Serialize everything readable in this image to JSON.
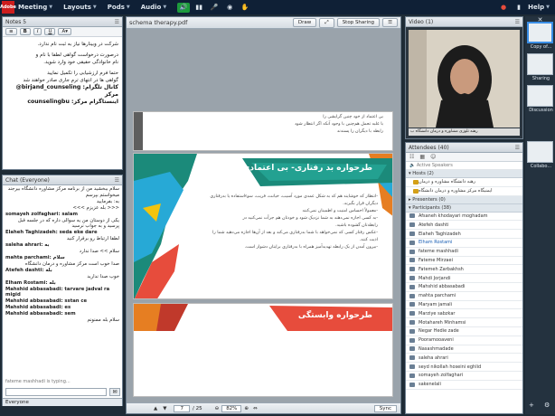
{
  "topbar": {
    "logo": "Adobe",
    "menus": [
      "Meeting",
      "Layouts",
      "Pods",
      "Audio"
    ],
    "help": "Help"
  },
  "notes": {
    "title": "Notes 5",
    "lines": [
      "شرکت در وبینارها نیاز به ثبت نام ندارد.",
      "درصورت درخواست گواهی لطفا با نام و",
      "نام خانوادگی حقیقی خود وارد شوید.",
      "",
      "حتما فرم ارزشیابی را تکمیل نمایید",
      "گواهی ها در انتهای ترم جاری صادر خواهند شد",
      "@birjand_counseling :کانال تلگرام مرکز",
      "counselingbu :اینستاگرام مرکز"
    ]
  },
  "chat": {
    "title": "Chat",
    "audience": "(Everyone)",
    "lines": [
      {
        "t": "سلام ببخشید من از برنامه مرکز مشاوره دانشگاه بیرجند",
        "rtl": true,
        "b": false
      },
      {
        "t": "میخواستم بپرسم",
        "rtl": true,
        "b": false
      },
      {
        "t": "به: بفرمایید",
        "rtl": true,
        "b": false
      },
      {
        "t": "<<< بله عزیزم >>>",
        "rtl": true,
        "b": false
      },
      {
        "t": "somayeh zolfaghari: salam",
        "rtl": false,
        "b": true
      },
      {
        "t": "یکی از دوستان من یه سوالی داره که در جلسه قبل پرسید و به جواب نرسید",
        "rtl": true,
        "b": false
      },
      {
        "t": "Elaheh Taghizadeh: seda eke dare",
        "rtl": false,
        "b": true
      },
      {
        "t": "لطفا ارتباط رو برقرار کنید",
        "rtl": true,
        "b": false
      },
      {
        "t": "saleha ahrari: به",
        "rtl": false,
        "b": true
      },
      {
        "t": "سلام >> صدا ندارد",
        "rtl": true,
        "b": false
      },
      {
        "t": "mahta parchami: سلام",
        "rtl": false,
        "b": true
      },
      {
        "t": "صدا خوب است مرکز مشاوره و درمان دانشگاه",
        "rtl": true,
        "b": false
      },
      {
        "t": "Atefeh dashti: بله",
        "rtl": false,
        "b": true
      },
      {
        "t": "خوب صدا ندارید",
        "rtl": true,
        "b": false
      },
      {
        "t": "Elham Rostami: بله",
        "rtl": false,
        "b": true
      },
      {
        "t": "Mahshid abbasabadi: tarvare jadval ra migid",
        "rtl": false,
        "b": true
      },
      {
        "t": "Mahshid abbasabadi: sstan ce",
        "rtl": false,
        "b": true
      },
      {
        "t": "Mahshid abbasabadi: es",
        "rtl": false,
        "b": true
      },
      {
        "t": "Mahshid abbasabadi: sem",
        "rtl": false,
        "b": true
      },
      {
        "t": "سلام بله ممنونم",
        "rtl": true,
        "b": false
      }
    ],
    "typing": "fateme mashhadi is typing...",
    "footer": "Everyone"
  },
  "doc": {
    "title": "schema therapy.pdf",
    "draw": "Draw",
    "stop": "Stop Sharing",
    "page": "7",
    "pages": "/ 25",
    "zoom": "82%",
    "sync": "Sync",
    "slide1_lines": [
      "بی اعتماد از خود چنین گرایشی را",
      "با غلبه تحمل هم‌چنین با وجود آنکه اگر انتظار شود",
      "رابطه با دیگران را پسندند"
    ],
    "slide2_title": "طرحواره بد رفتاری- بی اعتمادی",
    "slide2_lines": [
      "-انتظار که خوشایند هم که به شکل عمدی مورد آسیب، خیانت، فریب، سوءاستفاده یا بدرفتاری",
      "دیگران قرار بگیرند.",
      "-معمولاً احساس امنیت و اطمینان نمی‌کنند",
      "-به کسی اجازه نمی‌دهند به شما نزدیک شود و خودتان هم جرأت نمی‌کنید در",
      "رابطه‌تان گشوده باشید.",
      "-عکس رفتار کسی که نمی‌خواهد با شما بدرفتاری می‌کند و بعد از آن‌ها اجازه می‌دهید شما را",
      "اذیت کنند.",
      "-بیرون آمدن از یک رابطه تهدیدآمیز همراه با بدرفتاری برایتان دشوار است."
    ],
    "slide3_title": "طرحواره وابستگی"
  },
  "video": {
    "title": "Video",
    "count": "(1)",
    "caption": "رهنه تلوزی مشاوره و درمان دانشگاه ب"
  },
  "attendees": {
    "title": "Attendees",
    "count": "(40)",
    "active": "Active Speakers",
    "hosts_label": "Hosts (2)",
    "hosts": [
      "رهنه دانشگاه مشاوره و درمان",
      "ایمنیگاه مرکز مشاوره و درمان دانشگاه"
    ],
    "presenters_label": "Presenters (0)",
    "participants_label": "Participants (38)",
    "participants": [
      "Afsaneh khodayari moghadam",
      "Atefeh dashti",
      "Elaheh Taghizadeh",
      "Elham Rostami",
      "fateme mashhadi",
      "Fateme Mirzaei",
      "Fatemeh Zarbakhsh",
      "Mahdi Jorjandi",
      "Mahshid abbasabadi",
      "mahta parchami",
      "Maryam jamali",
      "Marziye sabzkar",
      "Motahareh Minhamsi",
      "Negar Hedie zade",
      "Pooramooaveni",
      "Nasashmadade",
      "saleha ahrari",
      "seyd nikollah hoseini eghlid",
      "somayeh zolfaghari",
      "sakenelali"
    ]
  },
  "sidebar": {
    "labels": [
      "Copy of...",
      "Sharing",
      "Discussion",
      "Collabo..."
    ]
  },
  "colors": {
    "topbar": "#0f2036",
    "accent": "#1a5fb4",
    "slide_teal": "#1b8a7a"
  }
}
